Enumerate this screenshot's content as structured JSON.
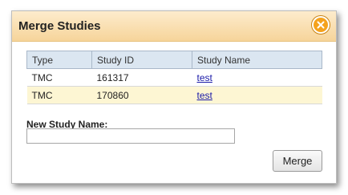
{
  "dialog": {
    "title": "Merge Studies",
    "close_icon": "close-icon",
    "accent_color": "#f5a21d"
  },
  "table": {
    "headers": [
      "Type",
      "Study ID",
      "Study Name"
    ],
    "rows": [
      {
        "type": "TMC",
        "study_id": "161317",
        "study_name": "test"
      },
      {
        "type": "TMC",
        "study_id": "170860",
        "study_name": "test"
      }
    ]
  },
  "form": {
    "new_name_label": "New Study Name:",
    "new_name_value": "",
    "merge_label": "Merge"
  }
}
